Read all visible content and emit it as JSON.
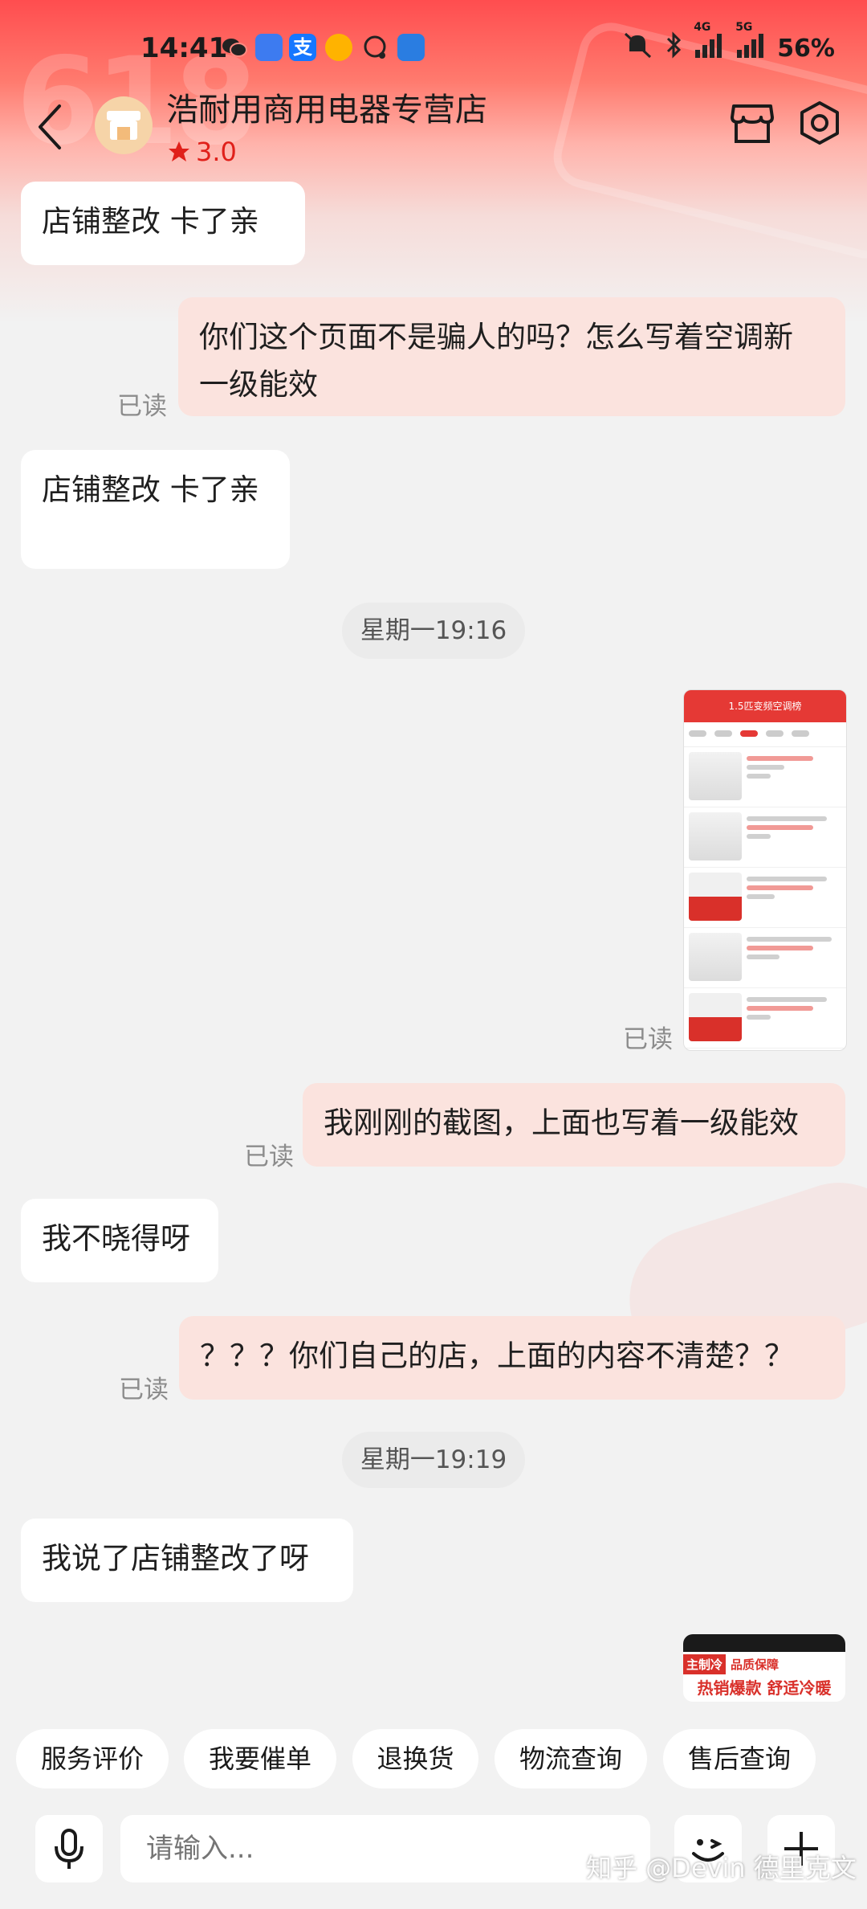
{
  "status_bar": {
    "time": "14:41",
    "network_1": "4G",
    "network_2": "5G",
    "battery": "56%"
  },
  "header": {
    "shop_name": "浩耐用商用电器专营店",
    "rating": "3.0",
    "icons": [
      "back-chevron-icon",
      "store-icon",
      "settings-hex-icon"
    ]
  },
  "messages": [
    {
      "side": "left",
      "text": "店铺整改  卡了亲"
    },
    {
      "side": "right",
      "line1": "你们这个页面不是骗人的吗？怎么写着空调新",
      "line2": "一级能效",
      "read": "已读"
    },
    {
      "side": "left",
      "text": "店铺整改 卡了亲"
    },
    {
      "type": "time",
      "text": "星期一19:16"
    },
    {
      "side": "right",
      "type": "image",
      "read": "已读",
      "screenshot_title": "1.5匹变频空调榜"
    },
    {
      "side": "right",
      "text": "我刚刚的截图，上面也写着一级能效",
      "read": "已读"
    },
    {
      "side": "left",
      "text": "我不晓得呀"
    },
    {
      "side": "right",
      "text": "？？？你们自己的店，上面的内容不清楚？？",
      "read": "已读"
    },
    {
      "type": "time",
      "text": "星期一19:19"
    },
    {
      "side": "left",
      "text": "我说了店铺整改了呀"
    },
    {
      "side": "right",
      "type": "promo",
      "tag": "主制冷",
      "tag2": "品质保障",
      "headline": "热销爆款 舒适冷暖"
    }
  ],
  "quick_actions": [
    "服务评价",
    "我要催单",
    "退换货",
    "物流查询",
    "售后查询"
  ],
  "input": {
    "placeholder": "请输入..."
  },
  "watermark": "知乎 @Devin 德里克文",
  "colors": {
    "brand_red": "#e53935",
    "bubble_right": "#fbe3de",
    "bubble_left": "#ffffff",
    "background": "#f2f2f2"
  }
}
